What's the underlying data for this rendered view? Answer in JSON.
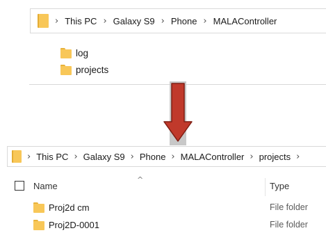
{
  "top_panel": {
    "breadcrumb": [
      "This PC",
      "Galaxy S9",
      "Phone",
      "MALAController"
    ],
    "separator": "›",
    "items": [
      {
        "name": "log",
        "icon": "folder-icon"
      },
      {
        "name": "projects",
        "icon": "folder-icon"
      }
    ]
  },
  "arrow": {
    "color": "#c0392b",
    "direction": "down"
  },
  "bottom_panel": {
    "breadcrumb": [
      "This PC",
      "Galaxy S9",
      "Phone",
      "MALAController",
      "projects"
    ],
    "separator": "›",
    "columns": {
      "name": "Name",
      "type": "Type",
      "sort_indicator": "^"
    },
    "rows": [
      {
        "name": "Proj2d cm",
        "type": "File folder"
      },
      {
        "name": "Proj2D-0001",
        "type": "File folder"
      }
    ]
  },
  "colors": {
    "folder": "#f8c758",
    "folder_tab": "#e8b23a",
    "arrow": "#c0392b",
    "arrow_background": "#c8c8c8"
  }
}
